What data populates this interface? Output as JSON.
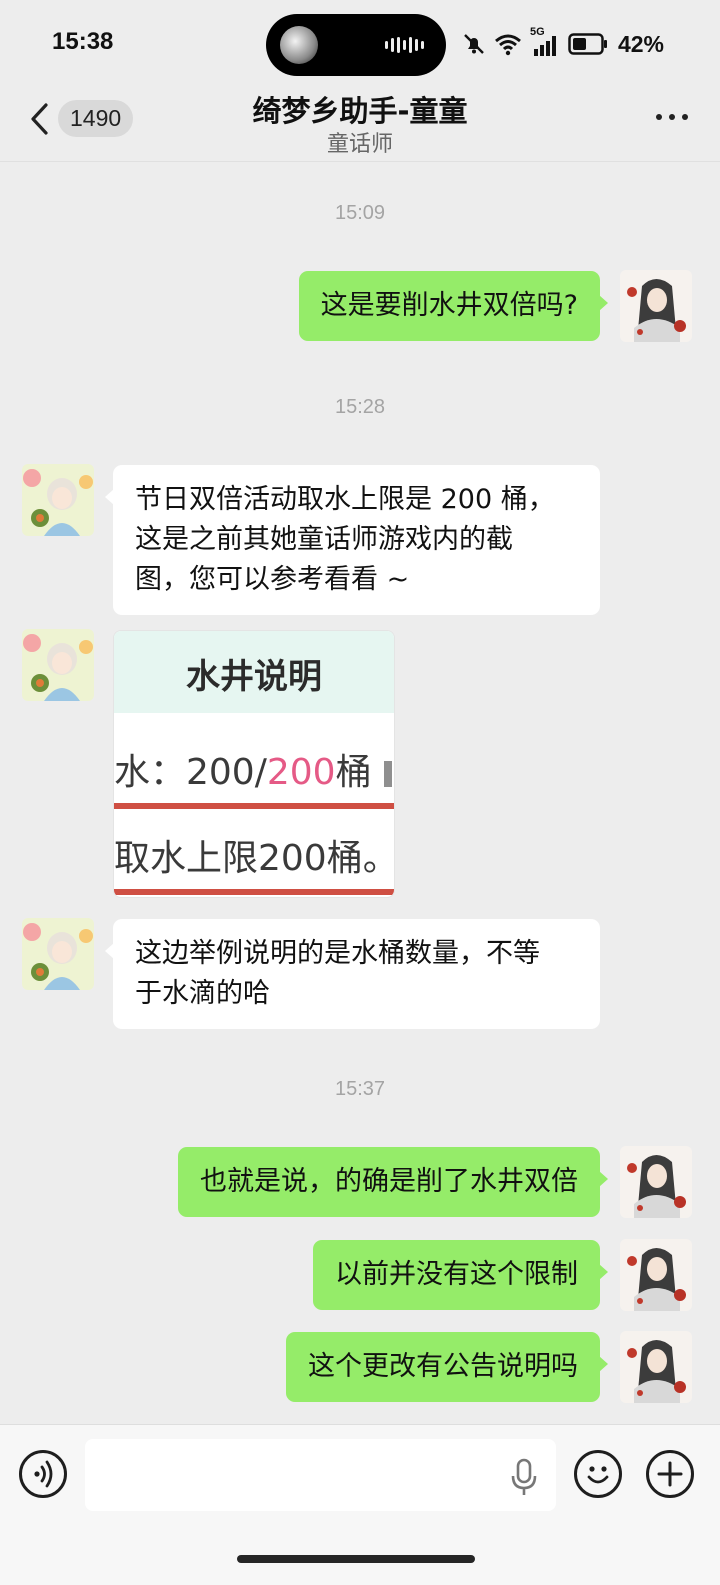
{
  "status_bar": {
    "time": "15:38",
    "network": "5G",
    "battery": "42%",
    "icons": [
      "mute-bell-icon",
      "wifi-icon",
      "cellular-signal-icon",
      "battery-icon"
    ]
  },
  "header": {
    "unread_count": "1490",
    "title": "绮梦乡助手-童童",
    "subtitle": "童话师"
  },
  "messages": [
    {
      "type": "timestamp",
      "text": "15:09"
    },
    {
      "type": "text",
      "side": "out",
      "text": "这是要削水井双倍吗?"
    },
    {
      "type": "timestamp",
      "text": "15:28"
    },
    {
      "type": "text",
      "side": "in",
      "lines": [
        "节日双倍活动取水上限是 200 桶，",
        "这是之前其她童话师游戏内的截",
        "图，您可以参考看看 ~"
      ]
    },
    {
      "type": "image",
      "side": "in",
      "image": {
        "title": "水井说明",
        "line1_prefix": "水：200/",
        "line1_highlight": "200",
        "line1_suffix": "桶",
        "line2": "取水上限200桶。"
      }
    },
    {
      "type": "text",
      "side": "in",
      "lines": [
        "这边举例说明的是水桶数量，不等",
        "于水滴的哈"
      ]
    },
    {
      "type": "timestamp",
      "text": "15:37"
    },
    {
      "type": "text",
      "side": "out",
      "text": "也就是说，的确是削了水井双倍"
    },
    {
      "type": "text",
      "side": "out",
      "text": "以前并没有这个限制"
    },
    {
      "type": "text",
      "side": "out",
      "text": "这个更改有公告说明吗"
    }
  ],
  "input": {
    "value": "",
    "placeholder": ""
  },
  "colors": {
    "chat_bg": "#ededed",
    "outgoing_bubble": "#95ec69",
    "incoming_bubble": "#ffffff",
    "image_highlight": "#e55a86",
    "image_bar": "#cf4f43"
  }
}
